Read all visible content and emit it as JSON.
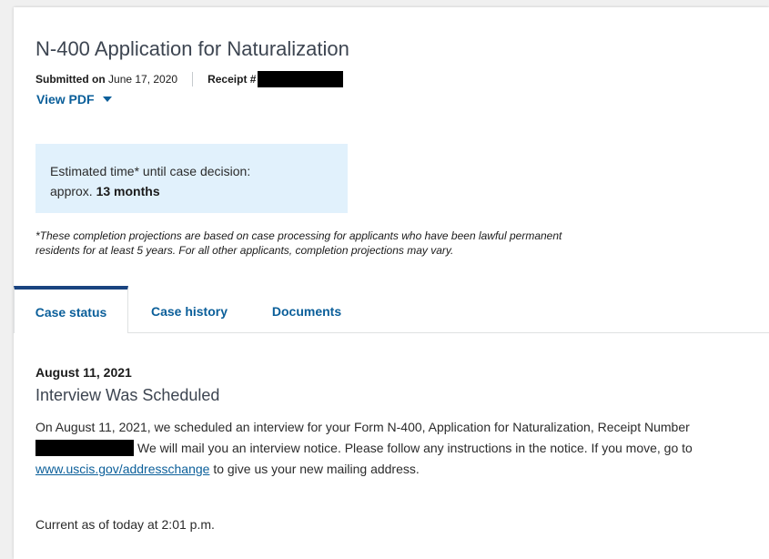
{
  "case": {
    "title": "N-400 Application for Naturalization",
    "submitted_label": "Submitted on",
    "submitted_date": "June 17, 2020",
    "receipt_label": "Receipt #",
    "view_pdf_label": "View PDF"
  },
  "estimate": {
    "line1": "Estimated time* until case decision:",
    "prefix": "approx. ",
    "value": "13 months"
  },
  "footnote": "*These completion projections are based on case processing for applicants who have been lawful permanent residents for at least 5 years. For all other applicants, completion projections may vary.",
  "tabs": [
    {
      "label": "Case status",
      "active": true
    },
    {
      "label": "Case history",
      "active": false
    },
    {
      "label": "Documents",
      "active": false
    }
  ],
  "event": {
    "date": "August 11, 2021",
    "title": "Interview Was Scheduled",
    "body_part1": "On August 11, 2021, we scheduled an interview for your Form N-400, Application for Naturalization, Receipt Number ",
    "body_part2": "We will mail you an interview notice. Please follow any instructions in the notice. If you move, go to ",
    "link_text": "www.uscis.gov/addresschange",
    "body_part3": " to give us your new mailing address."
  },
  "current_as_of": "Current as of today at 2:01 p.m.",
  "colors": {
    "link": "#0b5f9a",
    "active_tab_border": "#1a4480",
    "estimate_bg": "#e1f1fc"
  },
  "icons": {
    "view_pdf": "caret-down-icon"
  }
}
